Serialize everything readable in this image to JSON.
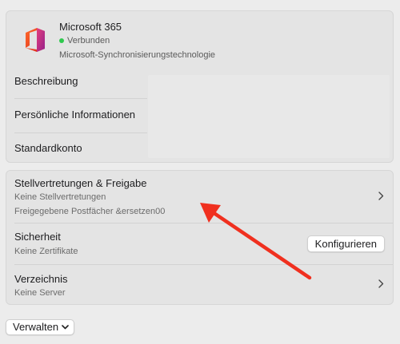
{
  "account": {
    "name": "Microsoft 365",
    "status": "Verbunden",
    "technology": "Microsoft-Synchronisierungstechnologie",
    "icon": "microsoft-office-icon",
    "status_color": "#2fc94e",
    "fields": [
      {
        "label": "Beschreibung"
      },
      {
        "label": "Persönliche Informationen"
      },
      {
        "label": "Standardkonto"
      }
    ]
  },
  "settings": {
    "delegation": {
      "title": "Stellvertretungen & Freigabe",
      "line1": "Keine Stellvertretungen",
      "line2": "Freigegebene Postfächer &ersetzen00"
    },
    "security": {
      "title": "Sicherheit",
      "sub": "Keine Zertifikate",
      "button": "Konfigurieren"
    },
    "directory": {
      "title": "Verzeichnis",
      "sub": "Keine Server"
    }
  },
  "footer": {
    "manage_label": "Verwalten"
  },
  "annotation": {
    "arrow_color": "#f0301f"
  }
}
